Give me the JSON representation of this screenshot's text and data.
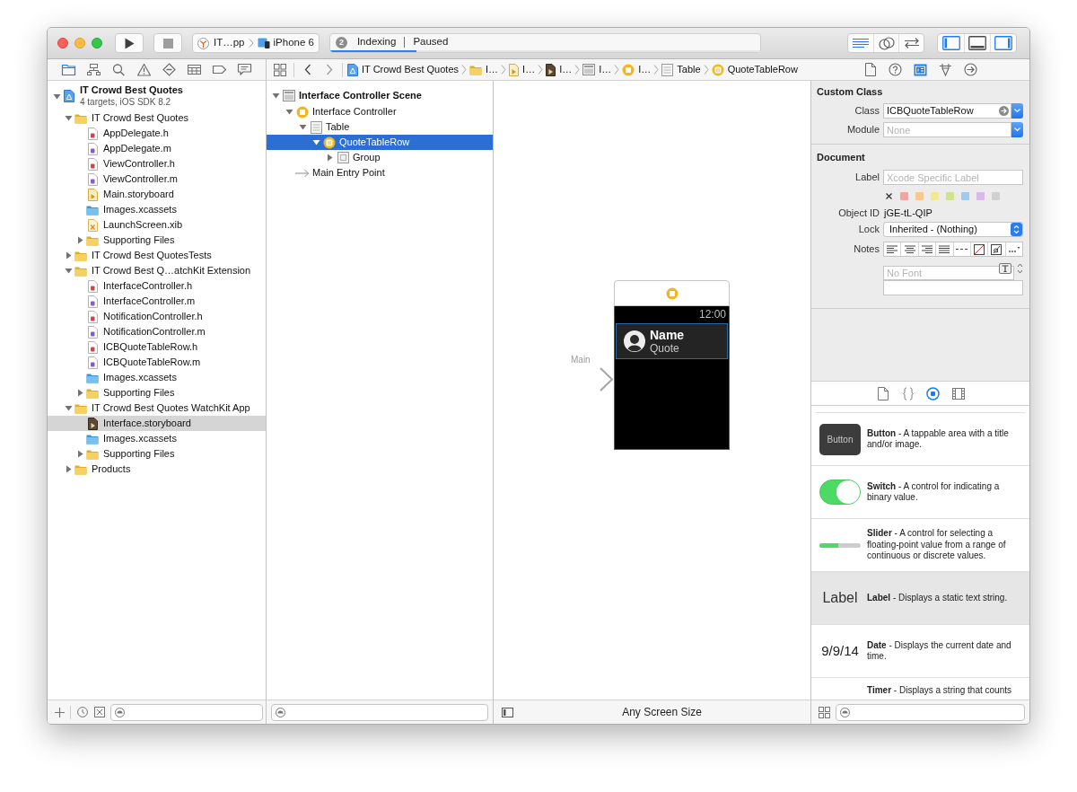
{
  "toolbar": {
    "scheme": {
      "target": "IT…pp",
      "device": "iPhone 6"
    },
    "activity": {
      "badge": "2",
      "status": "Indexing",
      "state": "Paused",
      "level": 0.2
    },
    "editor_modes": [
      {
        "kind": "standard",
        "selected": true
      },
      {
        "kind": "assistant",
        "selected": false
      },
      {
        "kind": "version",
        "selected": false
      }
    ],
    "view_toggles": [
      {
        "kind": "navigator",
        "on": true
      },
      {
        "kind": "debug",
        "on": false
      },
      {
        "kind": "utilities",
        "on": true
      }
    ]
  },
  "navigator_tabs": [
    {
      "kind": "project",
      "selected": true
    },
    {
      "kind": "symbol",
      "selected": false
    },
    {
      "kind": "find",
      "selected": false
    },
    {
      "kind": "issue",
      "selected": false
    },
    {
      "kind": "test",
      "selected": false
    },
    {
      "kind": "debug",
      "selected": false
    },
    {
      "kind": "breakpoint",
      "selected": false
    },
    {
      "kind": "report",
      "selected": false
    }
  ],
  "project_tree": [
    {
      "kind": "project",
      "label": "IT Crowd Best Quotes",
      "subtitle": "4 targets, iOS SDK 8.2",
      "expanded": true,
      "selected": false,
      "children": [
        {
          "kind": "folder",
          "label": "IT Crowd Best Quotes",
          "expanded": true,
          "selected": false,
          "children": [
            {
              "kind": "header",
              "label": "AppDelegate.h",
              "selected": false
            },
            {
              "kind": "source",
              "label": "AppDelegate.m",
              "selected": false
            },
            {
              "kind": "header",
              "label": "ViewController.h",
              "selected": false
            },
            {
              "kind": "source",
              "label": "ViewController.m",
              "selected": false
            },
            {
              "kind": "storyboard",
              "label": "Main.storyboard",
              "selected": false
            },
            {
              "kind": "assets",
              "label": "Images.xcassets",
              "selected": false
            },
            {
              "kind": "xib",
              "label": "LaunchScreen.xib",
              "selected": false
            },
            {
              "kind": "folder",
              "label": "Supporting Files",
              "expanded": false,
              "selected": false
            }
          ]
        },
        {
          "kind": "folder",
          "label": "IT Crowd Best QuotesTests",
          "expanded": false,
          "selected": false
        },
        {
          "kind": "folder",
          "label": "IT Crowd Best Q…atchKit Extension",
          "expanded": true,
          "selected": false,
          "children": [
            {
              "kind": "header",
              "label": "InterfaceController.h",
              "selected": false
            },
            {
              "kind": "source",
              "label": "InterfaceController.m",
              "selected": false
            },
            {
              "kind": "header",
              "label": "NotificationController.h",
              "selected": false
            },
            {
              "kind": "source",
              "label": "NotificationController.m",
              "selected": false
            },
            {
              "kind": "header",
              "label": "ICBQuoteTableRow.h",
              "selected": false
            },
            {
              "kind": "source",
              "label": "ICBQuoteTableRow.m",
              "selected": false
            },
            {
              "kind": "assets",
              "label": "Images.xcassets",
              "selected": false
            },
            {
              "kind": "folder",
              "label": "Supporting Files",
              "expanded": false,
              "selected": false
            }
          ]
        },
        {
          "kind": "folder",
          "label": "IT Crowd Best Quotes WatchKit App",
          "expanded": true,
          "selected": false,
          "children": [
            {
              "kind": "watch-storyboard",
              "label": "Interface.storyboard",
              "selected": true
            },
            {
              "kind": "assets",
              "label": "Images.xcassets",
              "selected": false
            },
            {
              "kind": "folder",
              "label": "Supporting Files",
              "expanded": false,
              "selected": false
            }
          ]
        },
        {
          "kind": "folder",
          "label": "Products",
          "expanded": false,
          "selected": false
        }
      ]
    }
  ],
  "jump_bar": [
    {
      "kind": "project",
      "label": "IT Crowd Best Quotes"
    },
    {
      "kind": "folder",
      "label": "I…"
    },
    {
      "kind": "storyboard",
      "label": "I…"
    },
    {
      "kind": "watch-storyboard",
      "label": "I…"
    },
    {
      "kind": "scene",
      "label": "I…"
    },
    {
      "kind": "controller",
      "label": "I…"
    },
    {
      "kind": "table",
      "label": "Table"
    },
    {
      "kind": "row",
      "label": "QuoteTableRow"
    }
  ],
  "outline": [
    {
      "kind": "scene",
      "label": "Interface Controller Scene",
      "expanded": true,
      "selected": false,
      "children": [
        {
          "kind": "controller",
          "label": "Interface Controller",
          "expanded": true,
          "selected": false,
          "children": [
            {
              "kind": "table",
              "label": "Table",
              "expanded": true,
              "selected": false,
              "children": [
                {
                  "kind": "row",
                  "label": "QuoteTableRow",
                  "expanded": true,
                  "selected": true,
                  "children": [
                    {
                      "kind": "group",
                      "label": "Group",
                      "expanded": false,
                      "selected": false
                    }
                  ]
                }
              ]
            }
          ]
        },
        {
          "kind": "entry",
          "label": "Main Entry Point",
          "selected": false
        }
      ]
    }
  ],
  "canvas": {
    "entry_label": "Main",
    "scene": {
      "time": "12:00",
      "row": {
        "title": "Name",
        "subtitle": "Quote"
      }
    },
    "footer": "Any Screen Size"
  },
  "inspector_tabs": [
    {
      "kind": "file",
      "selected": false
    },
    {
      "kind": "help",
      "selected": false
    },
    {
      "kind": "identity",
      "selected": true
    },
    {
      "kind": "attributes",
      "selected": false
    },
    {
      "kind": "connections",
      "selected": false
    }
  ],
  "inspector": {
    "custom_class": {
      "title": "Custom Class",
      "class_label": "Class",
      "class_value": "ICBQuoteTableRow",
      "module_label": "Module",
      "module_placeholder": "None"
    },
    "document": {
      "title": "Document",
      "label_label": "Label",
      "label_placeholder": "Xcode Specific Label",
      "label_colors": [
        {
          "color": "#f3a3a3"
        },
        {
          "color": "#f6c98c"
        },
        {
          "color": "#f4e88e"
        },
        {
          "color": "#cfe28f"
        },
        {
          "color": "#9fcbf3"
        },
        {
          "color": "#d8b9ea"
        },
        {
          "color": "#d0d0d0"
        }
      ],
      "object_id_label": "Object ID",
      "object_id": "jGE-tL-QIP",
      "lock_label": "Lock",
      "lock_value": "Inherited - (Nothing)",
      "notes_label": "Notes",
      "font_placeholder": "No Font"
    }
  },
  "library_tabs": [
    {
      "kind": "file",
      "selected": false
    },
    {
      "kind": "snippet",
      "selected": false
    },
    {
      "kind": "object",
      "selected": true
    },
    {
      "kind": "media",
      "selected": false
    }
  ],
  "library": [
    {
      "kind": "button",
      "preview": "Button",
      "text": "**Button** - A tappable area with a title and/or image.",
      "selected": false
    },
    {
      "kind": "switch",
      "on": true,
      "text": "**Switch** - A control for indicating a binary value.",
      "selected": false
    },
    {
      "kind": "slider",
      "level": 0.45,
      "text": "**Slider** - A control for selecting a floating-point value from a range of continuous or discrete values.",
      "selected": false
    },
    {
      "kind": "label",
      "preview": "Label",
      "text": "**Label** - Displays a static text string.",
      "selected": true
    },
    {
      "kind": "date",
      "preview": "9/9/14",
      "text": "**Date** - Displays the current date and time.",
      "selected": false
    },
    {
      "kind": "timer",
      "text": "**Timer** - Displays a string that counts",
      "selected": false
    }
  ]
}
